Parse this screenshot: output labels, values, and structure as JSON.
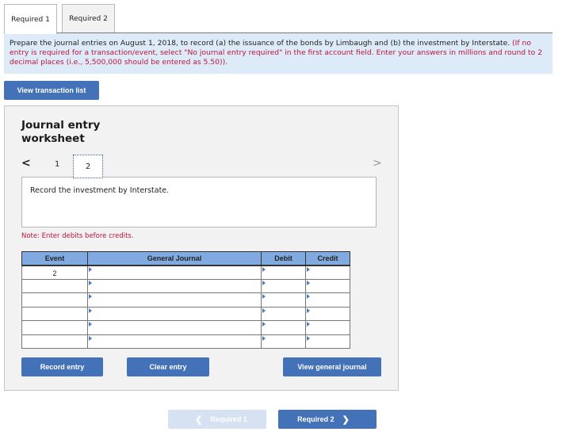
{
  "tabs": [
    {
      "label": "Required 1",
      "active": true
    },
    {
      "label": "Required 2",
      "active": false
    }
  ],
  "instructions": {
    "main": "Prepare the journal entries on August 1, 2018, to record (a) the issuance of the bonds by Limbaugh and (b) the investment by Interstate.",
    "note": "(If no entry is required for a transaction/event, select \"No journal entry required\" in the first account field. Enter your answers in millions and round to 2 decimal places (i.e., 5,500,000 should be entered as 5.50))."
  },
  "buttons": {
    "view_transaction_list": "View transaction list",
    "record_entry": "Record entry",
    "clear_entry": "Clear entry",
    "view_general_journal": "View general journal",
    "prev_required": "Required 1",
    "next_required": "Required 2"
  },
  "worksheet": {
    "title_line1": "Journal entry",
    "title_line2": "worksheet",
    "nav": {
      "prev": "<",
      "next": ">",
      "pages": [
        "1",
        "2"
      ],
      "current_page": "2"
    },
    "description": "Record the investment by Interstate.",
    "note": "Note: Enter debits before credits."
  },
  "journal_table": {
    "headers": [
      "Event",
      "General Journal",
      "Debit",
      "Credit"
    ],
    "rows": [
      {
        "event": "2",
        "account": "",
        "debit": "",
        "credit": ""
      },
      {
        "event": "",
        "account": "",
        "debit": "",
        "credit": ""
      },
      {
        "event": "",
        "account": "",
        "debit": "",
        "credit": ""
      },
      {
        "event": "",
        "account": "",
        "debit": "",
        "credit": ""
      },
      {
        "event": "",
        "account": "",
        "debit": "",
        "credit": ""
      },
      {
        "event": "",
        "account": "",
        "debit": "",
        "credit": ""
      }
    ]
  },
  "colors": {
    "primary_button": "#4472b8",
    "disabled_button": "#d6e1f1",
    "table_header": "#80aae0",
    "instruction_bg": "#dcebf7",
    "note_red": "#c0143c"
  }
}
